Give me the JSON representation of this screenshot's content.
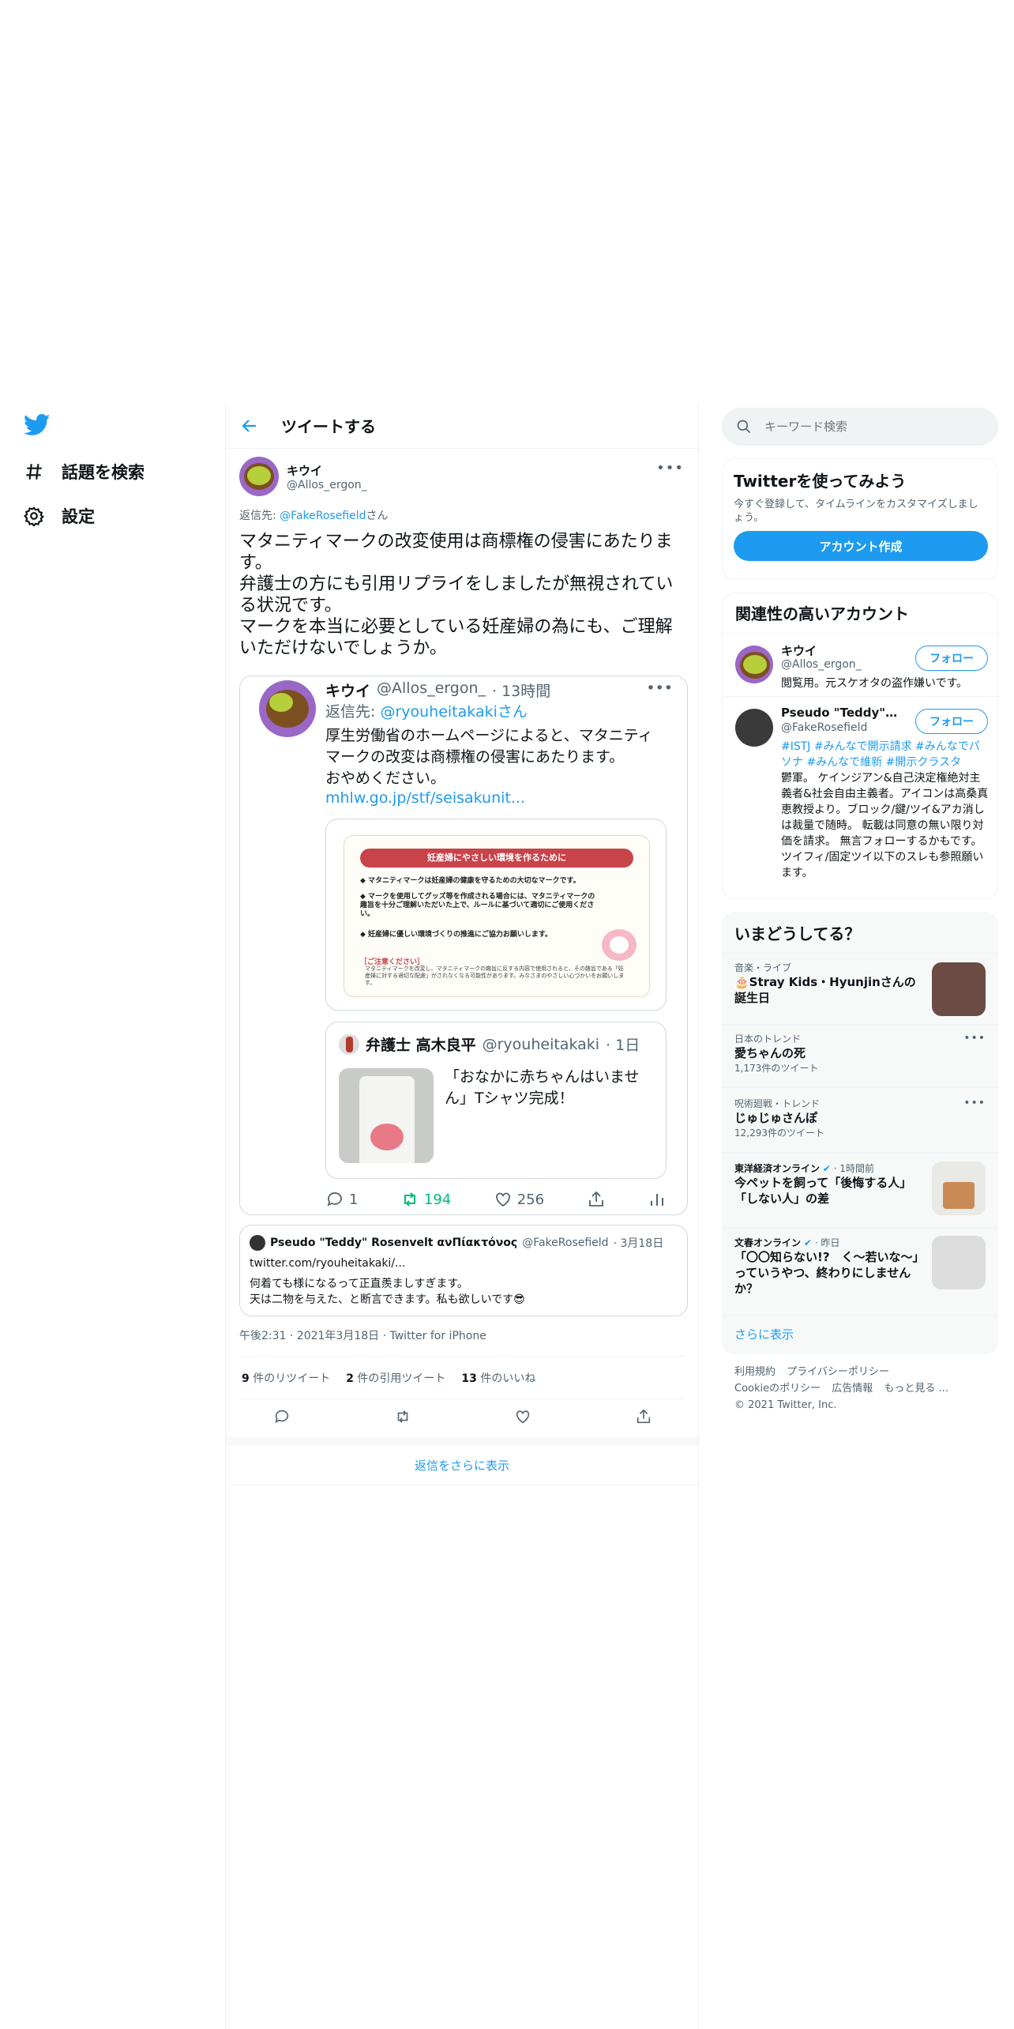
{
  "nav": {
    "explore_label": "話題を検索",
    "settings_label": "設定"
  },
  "header": {
    "title": "ツイートする"
  },
  "tweet": {
    "author_name": "キウイ",
    "author_handle": "@Allos_ergon_",
    "reply_prefix": "返信先: ",
    "reply_handle": "@FakeRosefield",
    "reply_suffix": "さん",
    "text": "マタニティマークの改変使用は商標権の侵害にあたります。\n弁護士の方にも引用リプライをしましたが無視されている状況です。\nマークを本当に必要としている妊産婦の為にも、ご理解いただけないでしょうか。",
    "timestamp": "午後2:31 · 2021年3月18日 · Twitter for iPhone",
    "retweets_count": "9",
    "retweets_label": " 件のリツイート",
    "quotes_count": "2",
    "quotes_label": " 件の引用ツイート",
    "likes_count": "13",
    "likes_label": " 件のいいね"
  },
  "quoted": {
    "author_name": "キウイ",
    "author_handle": "@Allos_ergon_",
    "time": "· 13時間",
    "reply_prefix": "返信先: ",
    "reply_handle": "@ryouheitakakiさん",
    "text": "厚生労働省のホームページによると、マタニティマークの改変は商標権の侵害にあたります。\nおやめください。",
    "link": "mhlw.go.jp/stf/seisakunit...",
    "poster": {
      "title": "妊産婦にやさしい環境を作るために",
      "line1": "◆ マタニティマークは妊産婦の健康を守るための大切なマークです。",
      "line2": "◆ マークを使用してグッズ等を作成される場合には、マタニティマークの趣旨を十分ご理解いただいた上で、ルールに基づいて適切にご使用ください。",
      "line3": "◆ 妊産婦に優しい環境づくりの推進にご協力お願いします。",
      "note_title": "［ご注意ください］",
      "note": "マタニティマークを改変し、マタニティマークの趣旨に反する内容で使用されると、その趣旨である「妊産婦に対する適切な配慮」がされなくなる可能性があります。みなさまのやさしい心づかいをお願いします。"
    },
    "inner_author": "弁護士 高木良平",
    "inner_handle": "@ryouheitakaki",
    "inner_time": "· 1日",
    "inner_text": "「おなかに赤ちゃんはいません」Tシャツ完成！",
    "replies": "1",
    "retweets": "194",
    "likes": "256"
  },
  "quoted2": {
    "author_name": "Pseudo \"Teddy\" Rosenvelt ανΠίακτόνος",
    "author_handle": "@FakeRosefield",
    "time": "· 3月18日",
    "link": "twitter.com/ryouheitakaki/...",
    "text": "何着ても様になるって正直羨ましすぎます。\n天は二物を与えた、と断言できます。私も欲しいです😎"
  },
  "show_more_replies": "返信をさらに表示",
  "search": {
    "placeholder": "キーワード検索"
  },
  "signup": {
    "title": "Twitterを使ってみよう",
    "desc": "今すぐ登録して、タイムラインをカスタマイズしましょう。",
    "button": "アカウント作成"
  },
  "who_to_follow": {
    "title": "関連性の高いアカウント",
    "follow_label": "フォロー",
    "accounts": [
      {
        "name": "キウイ",
        "handle": "@Allos_ergon_",
        "bio": "閲覧用。元スケオタの盗作嫌いです。"
      },
      {
        "name": "Pseudo \"Teddy\" Ros...",
        "handle": "@FakeRosefield",
        "bio_tags": "#ISTJ #みんなで開示請求 #みんなでパソナ #みんなで維新 #開示クラスタ",
        "bio": "鬱軍。 ケインジアン&自己決定権絶対主義者&社会自由主義者。アイコンは高桑真恵教授より。ブロック/鍵/ツイ&アカ消しは裁量で随時。 転載は同意の無い限り対価を請求。 無言フォローするかもです。ツイフィ/固定ツイ以下のスレも参照願います。"
      }
    ]
  },
  "trends": {
    "title": "いまどうしてる？",
    "items": [
      {
        "context": "音楽・ライブ",
        "title": "🎂Stray Kids・Hyunjinさんの誕生日",
        "count": ""
      },
      {
        "context": "日本のトレンド",
        "title": "愛ちゃんの死",
        "count": "1,173件のツイート"
      },
      {
        "context": "呪術廻戦・トレンド",
        "title": "じゅじゅさんぽ",
        "count": "12,293件のツイート"
      },
      {
        "context": "東洋経済オンライン",
        "time": "· 1時間前",
        "title": "今ペットを飼って「後悔する人」「しない人」の差",
        "count": ""
      },
      {
        "context": "文春オンライン",
        "time": "· 昨日",
        "title": "「〇〇知らない!?　く～若いな～」っていうやつ、終わりにしませんか？",
        "count": ""
      }
    ],
    "show_more": "さらに表示"
  },
  "footer": {
    "links": [
      "利用規約",
      "プライバシーポリシー",
      "Cookieのポリシー",
      "広告情報",
      "もっと見る ..."
    ],
    "copyright": "© 2021 Twitter, Inc."
  },
  "colors": {
    "accent": "#1d9bf0",
    "retweet": "#00ba7c",
    "text": "#0f1419",
    "muted": "#536471"
  }
}
